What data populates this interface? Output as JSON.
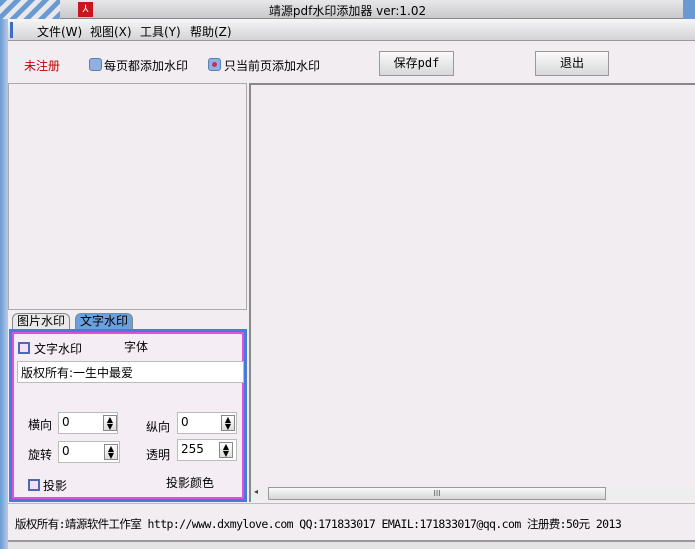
{
  "window": {
    "title": "靖源pdf水印添加器 ver:1.02"
  },
  "menu": [
    "文件(W)",
    "视图(X)",
    "工具(Y)",
    "帮助(Z)"
  ],
  "toolbar": {
    "status": "未注册",
    "radio_all": "每页都添加水印",
    "radio_current": "只当前页添加水印",
    "selected": "只当前页添加水印",
    "save": "保存pdf",
    "exit": "退出"
  },
  "tabs": [
    "图片水印",
    "文字水印"
  ],
  "active_tab": "文字水印",
  "text_panel": {
    "checkbox_label": "文字水印",
    "font_label": "字体",
    "text_value": "版权所有:一生中最爱",
    "horizontal_label": "横向",
    "horizontal": "0",
    "vertical_label": "纵向",
    "vertical": "0",
    "rotate_label": "旋转",
    "rotate": "0",
    "opacity_label": "透明",
    "opacity": "255",
    "shadow_label": "投影",
    "shadow_color_label": "投影颜色"
  },
  "scroll_thumb": "III",
  "footer": "版权所有:靖源软件工作室 http://www.dxmylove.com QQ:171833017 EMAIL:171833017@qq.com 注册费:50元 2013"
}
